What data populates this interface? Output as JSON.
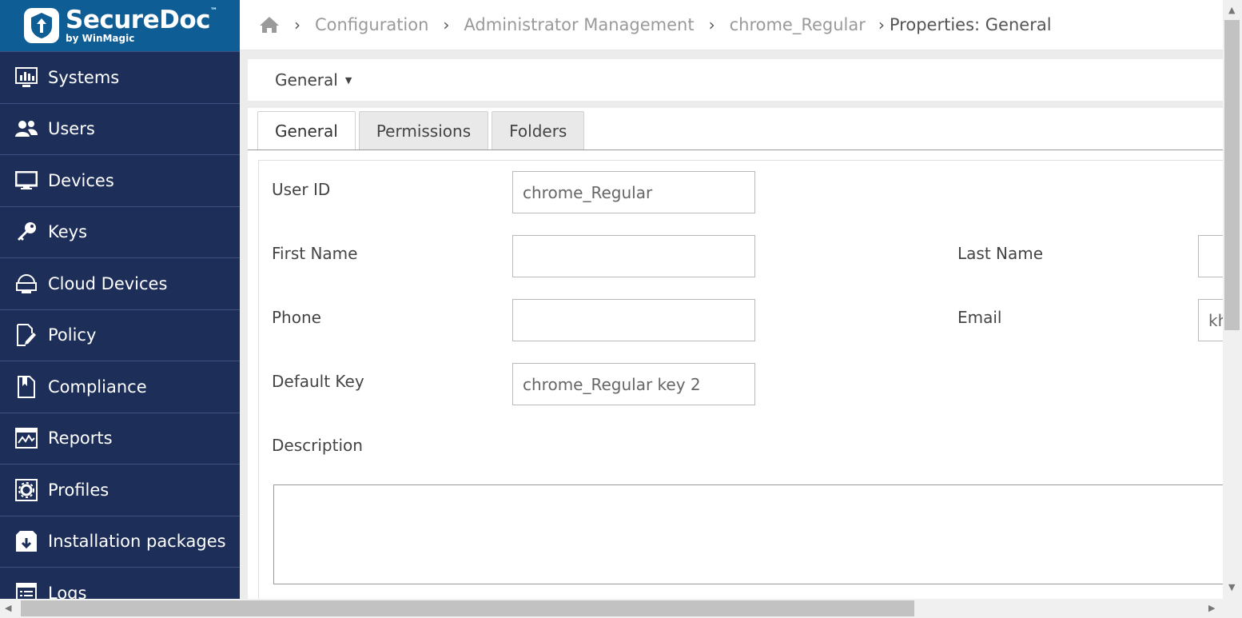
{
  "brand": {
    "name": "SecureDoc",
    "tm": "™",
    "sub": "by WinMagic"
  },
  "sidebar": {
    "items": [
      {
        "label": "Systems",
        "icon": "systems-icon"
      },
      {
        "label": "Users",
        "icon": "users-icon"
      },
      {
        "label": "Devices",
        "icon": "monitor-icon"
      },
      {
        "label": "Keys",
        "icon": "key-icon"
      },
      {
        "label": "Cloud Devices",
        "icon": "cloud-device-icon"
      },
      {
        "label": "Policy",
        "icon": "policy-icon"
      },
      {
        "label": "Compliance",
        "icon": "compliance-icon"
      },
      {
        "label": "Reports",
        "icon": "reports-icon"
      },
      {
        "label": "Profiles",
        "icon": "profiles-icon"
      },
      {
        "label": "Installation packages",
        "icon": "package-icon"
      },
      {
        "label": "Logs",
        "icon": "logs-icon"
      }
    ]
  },
  "breadcrumb": {
    "home_icon": "home-icon",
    "items": [
      "Configuration",
      "Administrator Management",
      "chrome_Regular",
      "Properties: General"
    ]
  },
  "subheader": {
    "dropdown_label": "General"
  },
  "tabs": [
    "General",
    "Permissions",
    "Folders"
  ],
  "active_tab": "General",
  "form": {
    "user_id": {
      "label": "User ID",
      "value": "chrome_Regular"
    },
    "first_name": {
      "label": "First Name",
      "value": ""
    },
    "last_name": {
      "label": "Last Name",
      "value": ""
    },
    "phone": {
      "label": "Phone",
      "value": ""
    },
    "email": {
      "label": "Email",
      "value": "kh"
    },
    "default_key": {
      "label": "Default Key",
      "value": "chrome_Regular key 2"
    },
    "description": {
      "label": "Description",
      "value": ""
    }
  },
  "colors": {
    "sidebar_bg": "#1d2e58",
    "logo_bg": "#0f5d95",
    "accent": "#ffffff"
  }
}
